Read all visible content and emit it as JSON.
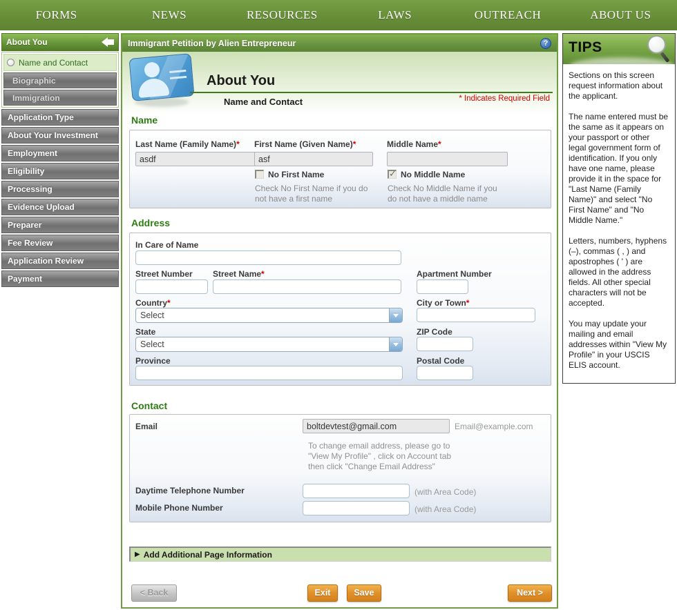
{
  "topnav": {
    "items": [
      "FORMS",
      "NEWS",
      "RESOURCES",
      "LAWS",
      "OUTREACH",
      "ABOUT US"
    ]
  },
  "sidebar": {
    "header": "About You",
    "selected_item": "Name and Contact",
    "sub_items": [
      "Biographic",
      "Immigration"
    ],
    "sections": [
      "Application Type",
      "About Your Investment",
      "Employment",
      "Eligibility",
      "Processing",
      "Evidence Upload",
      "Preparer",
      "Fee Review",
      "Application Review",
      "Payment"
    ]
  },
  "header": {
    "form_title": "Immigrant Petition by Alien Entrepreneur",
    "help_glyph": "?",
    "page_title": "About You",
    "page_subtitle": "Name and Contact",
    "required_note": "* Indicates Required Field",
    "required_star": "*"
  },
  "name_section": {
    "heading": "Name",
    "last_name": {
      "label": "Last Name (Family Name)",
      "value": "asdf"
    },
    "first_name": {
      "label": "First Name (Given Name)",
      "value": "asf"
    },
    "middle_name": {
      "label": "Middle Name",
      "value": ""
    },
    "no_first_name": {
      "label": "No First Name",
      "checked": "false",
      "help": "Check No First Name if you do not have a first name"
    },
    "no_middle_name": {
      "label": "No Middle Name",
      "checked": "true",
      "help": "Check No Middle Name if you do not have a middle name"
    }
  },
  "address_section": {
    "heading": "Address",
    "in_care_of": {
      "label": "In Care of Name",
      "value": ""
    },
    "street_number": {
      "label": "Street Number",
      "value": ""
    },
    "street_name": {
      "label": "Street Name",
      "value": ""
    },
    "apartment_number": {
      "label": "Apartment Number",
      "value": ""
    },
    "country": {
      "label": "Country",
      "selected": "Select"
    },
    "city": {
      "label": "City or Town",
      "value": ""
    },
    "state": {
      "label": "State",
      "selected": "Select"
    },
    "zip": {
      "label": "ZIP Code",
      "value": ""
    },
    "province": {
      "label": "Province",
      "value": ""
    },
    "postal": {
      "label": "Postal Code",
      "value": ""
    }
  },
  "contact_section": {
    "heading": "Contact",
    "email": {
      "label": "Email",
      "value": "boltdevtest@gmail.com",
      "hint": "Email@example.com",
      "note": "To change email address, please go to \"View My Profile\" , click on Account tab then click \"Change Email Address\""
    },
    "daytime_phone": {
      "label": "Daytime Telephone Number",
      "value": "",
      "hint": "(with Area Code)"
    },
    "mobile_phone": {
      "label": "Mobile Phone Number",
      "value": "",
      "hint": "(with Area Code)"
    }
  },
  "expander": {
    "arrow": "▶",
    "label": "Add Additional Page Information"
  },
  "buttons": {
    "back": "< Back",
    "exit": "Exit",
    "save": "Save",
    "next": "Next >"
  },
  "tips": {
    "title": "TIPS",
    "paragraphs": [
      "Sections on this screen request information about the applicant.",
      "The name entered must be the same as it appears on your passport or other legal government form of identification. If you only have one name, please provide it in the space for \"Last Name (Family Name)\" and select \"No First Name\" and \"No Middle Name.\"",
      "Letters, numbers, hyphens (–), commas ( , ) and apostrophes ( ' ) are allowed in the address fields. All other special characters will not be accepted.",
      "You may update your mailing and email addresses within \"View My Profile\" in your USCIS ELIS account."
    ]
  }
}
